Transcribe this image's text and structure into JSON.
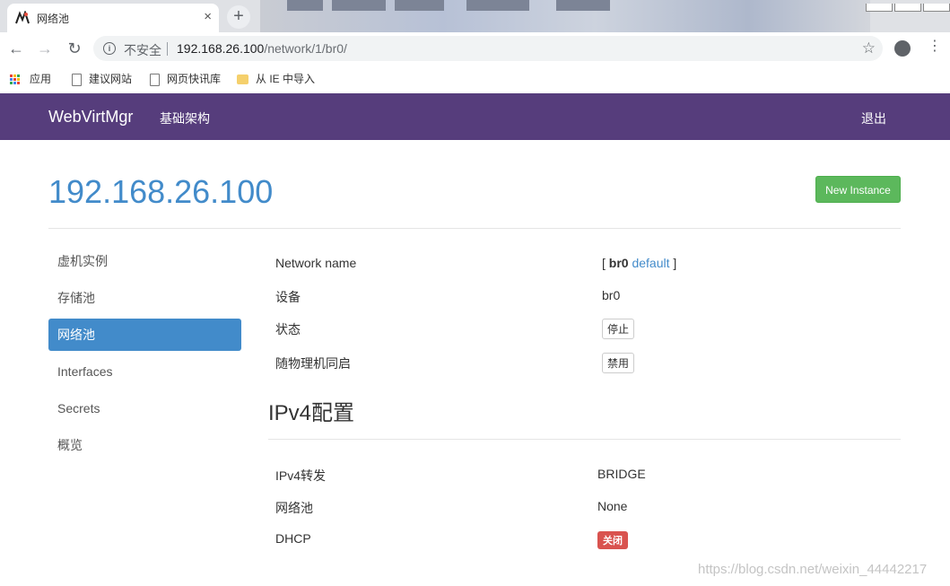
{
  "browser": {
    "tab_title": "网络池",
    "new_tab_symbol": "+",
    "close_symbol": "×",
    "security_text": "不安全",
    "url_host": "192.168.26.100",
    "url_path": "/network/1/br0/",
    "bookmarks": [
      "应用",
      "建议网站",
      "网页快讯库",
      "从 IE 中导入"
    ]
  },
  "navbar": {
    "brand": "WebVirtMgr",
    "infrastructure": "基础架构",
    "logout": "退出",
    "bg_color": "#563d7c"
  },
  "page": {
    "hostname": "192.168.26.100",
    "new_instance_button": "New Instance"
  },
  "sidebar": {
    "items": [
      {
        "label": "虚机实例",
        "active": false
      },
      {
        "label": "存储池",
        "active": false
      },
      {
        "label": "网络池",
        "active": true
      },
      {
        "label": "Interfaces",
        "active": false
      },
      {
        "label": "Secrets",
        "active": false
      },
      {
        "label": "概览",
        "active": false
      }
    ]
  },
  "network": {
    "name_label": "Network name",
    "name_open_bracket": "[",
    "name_value": "br0",
    "name_default_link": "default",
    "name_close_bracket": "]",
    "device_label": "设备",
    "device_value": "br0",
    "state_label": "状态",
    "state_button": "停止",
    "autostart_label": "随物理机同启",
    "autostart_button": "禁用"
  },
  "ipv4": {
    "heading": "IPv4配置",
    "forward_label": "IPv4转发",
    "forward_value": "BRIDGE",
    "pool_label": "网络池",
    "pool_value": "None",
    "dhcp_label": "DHCP",
    "dhcp_value": "关闭"
  },
  "watermark": "https://blog.csdn.net/weixin_44442217",
  "colors": {
    "link": "#428bca",
    "success": "#5cb85c",
    "danger": "#d9534f"
  }
}
